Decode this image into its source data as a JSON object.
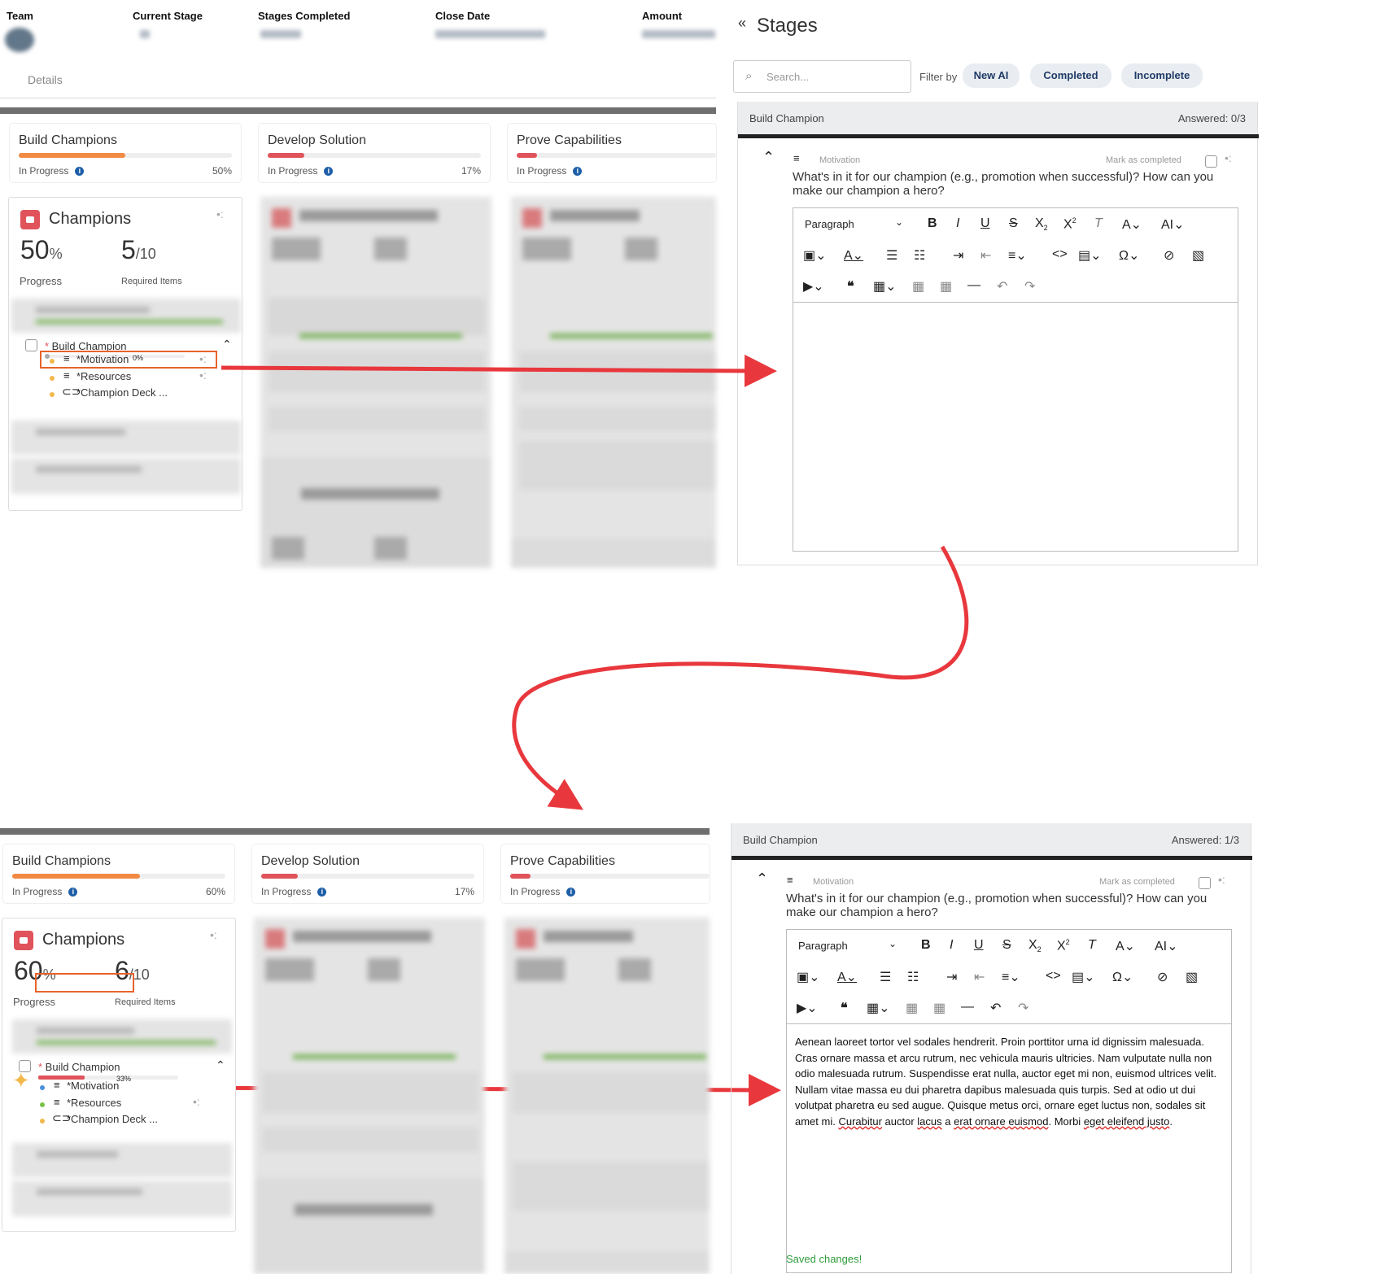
{
  "header": {
    "team_label": "Team",
    "current_stage_label": "Current Stage",
    "stages_completed_label": "Stages Completed",
    "close_date_label": "Close Date",
    "amount_label": "Amount",
    "details_tab": "Details"
  },
  "before": {
    "stages": [
      {
        "name": "Build Champions",
        "status": "In Progress",
        "pct": "50%",
        "progress": 0.5,
        "color": "#f28a44"
      },
      {
        "name": "Develop Solution",
        "status": "In Progress",
        "pct": "17%",
        "progress": 0.17,
        "color": "#e0535b"
      },
      {
        "name": "Prove Capabilities",
        "status": "In Progress",
        "pct": "",
        "progress": 0.1,
        "color": "#e0535b"
      }
    ],
    "card": {
      "title": "Champions",
      "progress_num": "50",
      "progress_unit": "%",
      "progress_label": "Progress",
      "req_num": "5",
      "req_unit": "/10",
      "req_label": "Required Items",
      "item_title": "Build Champion",
      "item_pct": "0%",
      "item_progress": 0,
      "subitems": [
        "*Motivation",
        "*Resources",
        "*Champion Deck ..."
      ]
    },
    "panel": {
      "back_icon": "«",
      "title": "Stages",
      "search_placeholder": "Search...",
      "filter_label": "Filter by",
      "filters": [
        "New AI",
        "Completed",
        "Incomplete"
      ],
      "section": "Build Champion",
      "answered": "Answered: 0/3",
      "question_type": "Motivation",
      "mark_completed": "Mark as completed",
      "question": "What's in it for our champion (e.g., promotion when successful)? How can you make our champion a hero?",
      "paragraph_label": "Paragraph"
    }
  },
  "after": {
    "stages": [
      {
        "name": "Build Champions",
        "status": "In Progress",
        "pct": "60%",
        "progress": 0.6,
        "color": "#f28a44"
      },
      {
        "name": "Develop Solution",
        "status": "In Progress",
        "pct": "17%",
        "progress": 0.17,
        "color": "#e0535b"
      },
      {
        "name": "Prove Capabilities",
        "status": "In Progress",
        "pct": "",
        "progress": 0.1,
        "color": "#e0535b"
      }
    ],
    "card": {
      "title": "Champions",
      "progress_num": "60",
      "progress_unit": "%",
      "progress_label": "Progress",
      "req_num": "6",
      "req_unit": "/10",
      "req_label": "Required Items",
      "item_title": "Build Champion",
      "item_pct": "33%",
      "item_progress": 0.33,
      "subitems": [
        "*Motivation",
        "*Resources",
        "*Champion Deck ..."
      ]
    },
    "panel": {
      "section": "Build Champion",
      "answered": "Answered: 1/3",
      "question_type": "Motivation",
      "mark_completed": "Mark as completed",
      "question": "What's in it for our champion (e.g., promotion when successful)? How can you make our champion a hero?",
      "paragraph_label": "Paragraph",
      "body_a": "Aenean laoreet tortor vel sodales hendrerit. Proin porttitor urna id dignissim malesuada. Cras ornare massa et arcu rutrum, nec vehicula mauris ultricies. Nam vulputate nulla non odio malesuada rutrum. Suspendisse erat nulla, auctor eget mi non, euismod ultrices velit. Nullam vitae massa eu dui pharetra dapibus malesuada quis turpis. Sed at odio ut dui volutpat pharetra eu sed augue. Quisque metus orci, ornare eget luctus non, sodales sit amet mi. ",
      "body_w1": "Curabitur",
      "body_b": " auctor ",
      "body_w2": "lacus",
      "body_c": " a ",
      "body_w3": "erat ornare euismod",
      "body_d": ". Morbi ",
      "body_w4": "eget eleifend justo",
      "body_e": ".",
      "saved": "Saved changes!"
    }
  },
  "colors": {
    "accent_arrow": "#e8383d",
    "highlight": "#e8632b"
  }
}
